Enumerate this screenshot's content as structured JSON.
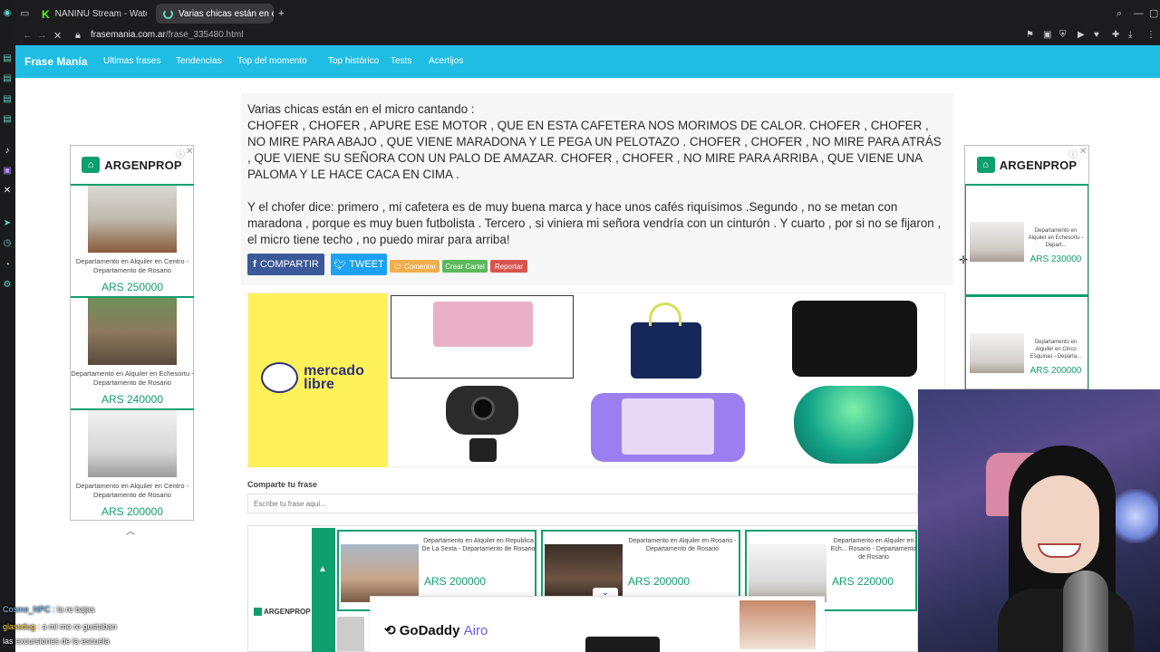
{
  "browser": {
    "tabs": [
      {
        "title": "NANINU Stream - Watch l",
        "active": false
      },
      {
        "title": "Varias chicas están en el",
        "active": true
      }
    ],
    "new_tab_icon": "plus-icon",
    "url_domain": "frasemania.com.ar",
    "url_path": "/frase_335480.html"
  },
  "site": {
    "brand": "Frase Manía",
    "nav": [
      "Ultimas frases",
      "Tendencias",
      "Top del momento",
      "Top histórico",
      "Tests",
      "Acertijos"
    ],
    "accent": "#1fbde4"
  },
  "phrase": {
    "intro": "Varias chicas están en el micro cantando :",
    "song": "CHOFER , CHOFER , APURE ESE MOTOR , QUE EN ESTA CAFETERA NOS MORIMOS DE CALOR. CHOFER , CHOFER , NO MIRE PARA ABAJO , QUE VIENE MARADONA Y LE PEGA UN PELOTAZO . CHOFER , CHOFER , NO MIRE PARA ATRÁS , QUE VIENE SU SEÑORA CON UN PALO DE AMAZAR. CHOFER , CHOFER , NO MIRE PARA ARRIBA , QUE VIENE UNA PALOMA Y LE HACE CACA EN CIMA .",
    "answer": "Y el chofer dice: primero , mi cafetera es de muy buena marca y hace unos cafés riquísimos .Segundo , no se metan con maradona , porque es muy buen futbolista . Tercero , si viniera mi señora vendría con un cinturón . Y cuarto , por si no se fijaron , el micro tiene techo , no puedo mirar para arriba!"
  },
  "actions": {
    "share": "COMPARTIR",
    "tweet": "TWEET",
    "comment": "Comentar",
    "create_poster": "Crear Cartel",
    "report": "Reportar"
  },
  "ads": {
    "argenprop_brand": "ARGENPROP",
    "left": [
      {
        "caption": "Departamento en Alquiler en Centro - Departamento de Rosario",
        "price": "ARS 250000"
      },
      {
        "caption": "Departamento en Alquiler en Echesortu - Departamento de Rosario",
        "price": "ARS 240000"
      },
      {
        "caption": "Departamento en Alquiler en Centro - Departamento de Rosario",
        "price": "ARS 200000"
      }
    ],
    "right": [
      {
        "caption": "Departamento en Alquiler en Echesortu - Depart...",
        "price": "ARS 230000"
      },
      {
        "caption": "Departamento en Alquiler en Cinco Esquinas - Departa...",
        "price": "ARS 200000"
      }
    ],
    "bottom": [
      {
        "caption": "Departamento en Alquiler en Republica De La Sexta - Departamento de Rosario",
        "price": "ARS 200000"
      },
      {
        "caption": "Departamento en Alquiler en Rosario - Departamento de Rosario",
        "price": "ARS 200000"
      },
      {
        "caption": "Departamento en Alquiler en Ech... Rosario - Departamento de Rosario",
        "price": "ARS 220000"
      }
    ],
    "mercado_libre": "mercado libre",
    "godaddy_brand": "GoDaddy",
    "godaddy_product": "Airo"
  },
  "share_form": {
    "label": "Comparte tu frase",
    "placeholder": "Escribe tu frase aquí..."
  },
  "chat": [
    {
      "user": "Cosme_NPC",
      "message": ": la re bajas"
    },
    {
      "user": "glassdug",
      "message": ": a mi me re gustaban"
    },
    {
      "user": "",
      "message": "las excursiones de la escuela"
    }
  ]
}
